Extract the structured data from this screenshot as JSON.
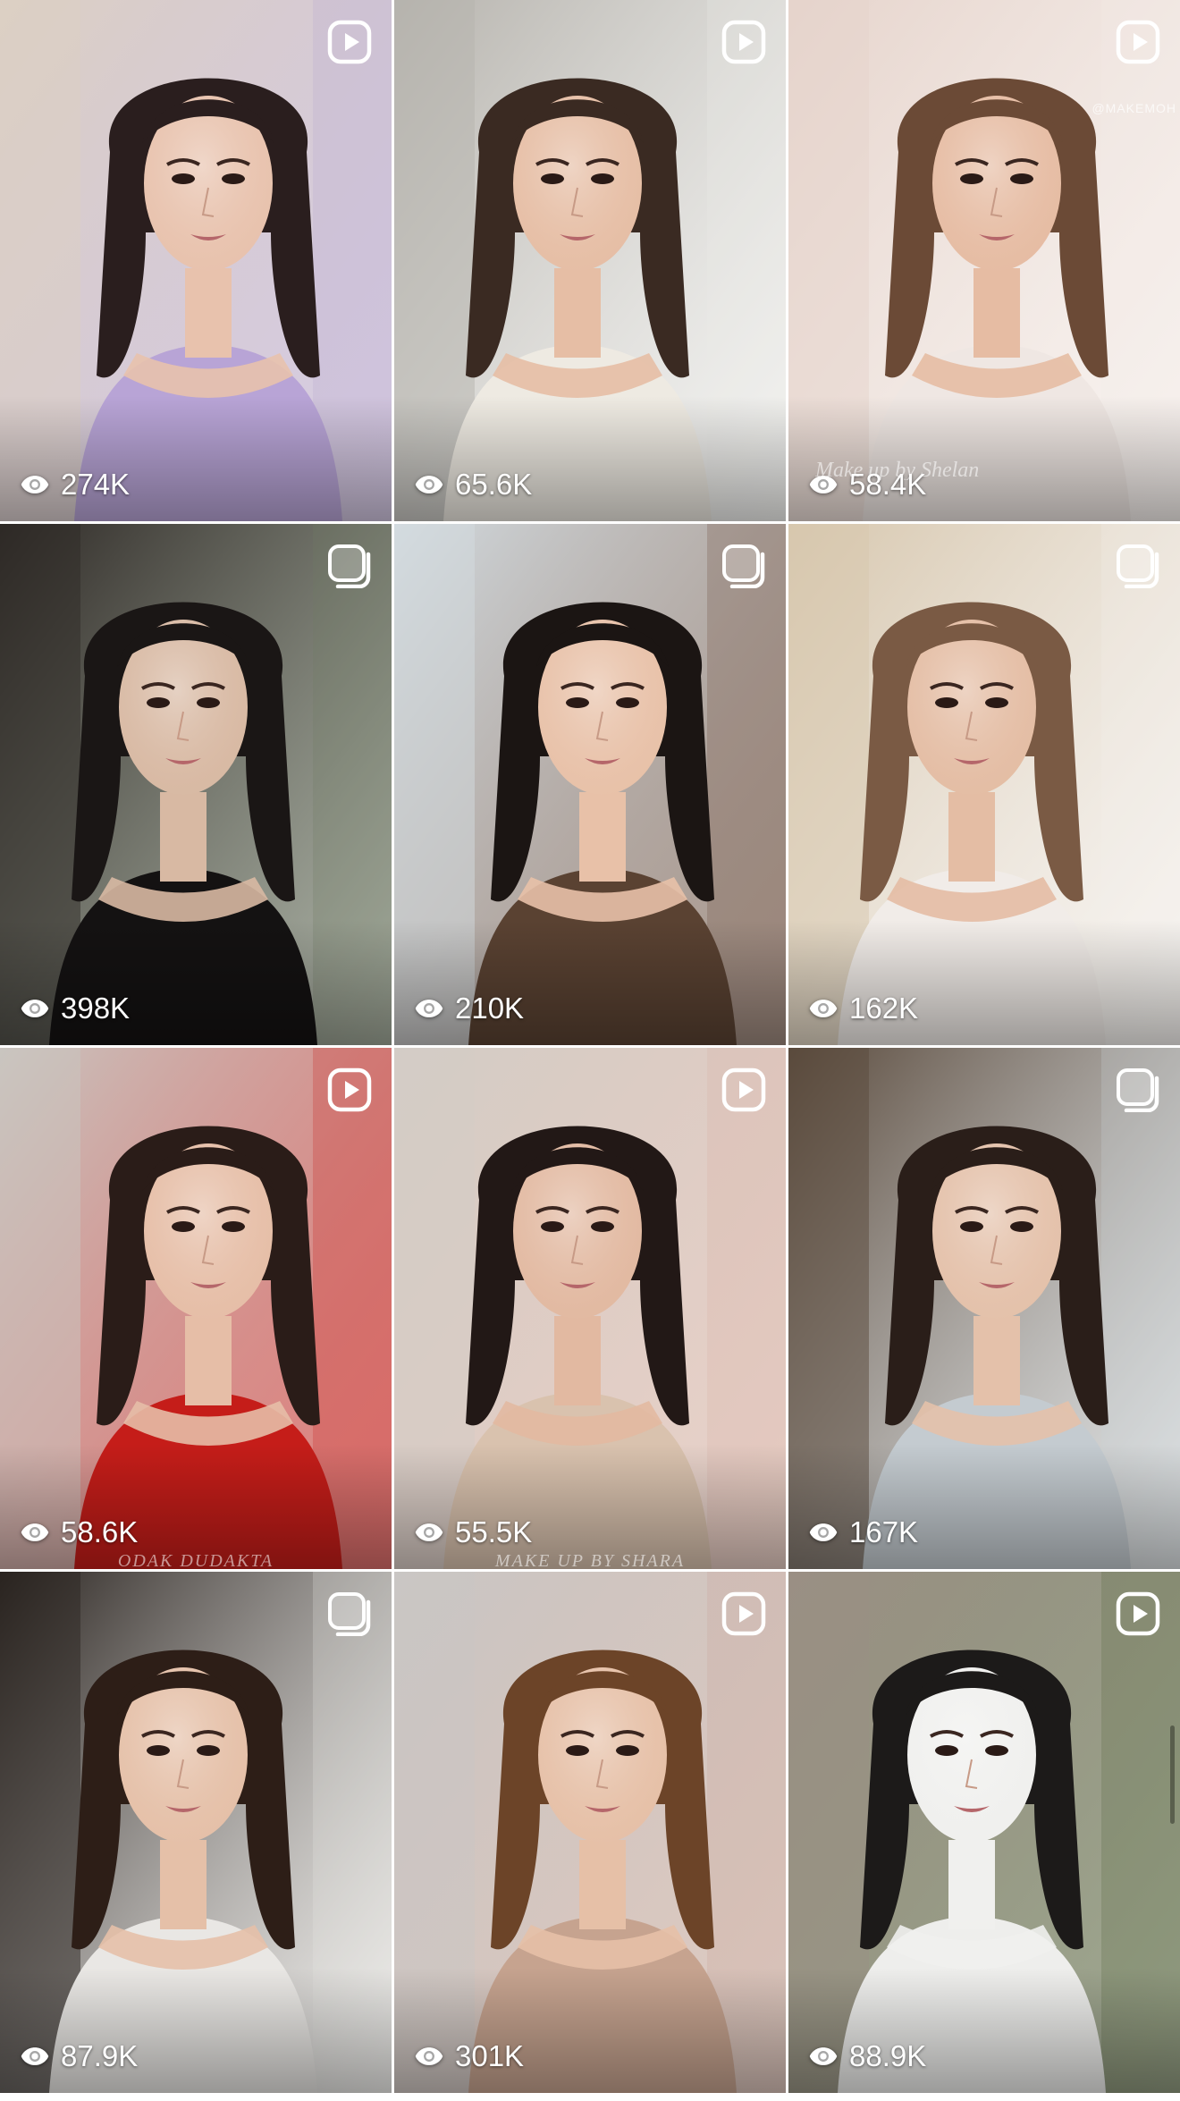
{
  "tiles": [
    {
      "views": "274K",
      "type": "reel",
      "caption": "",
      "palette": {
        "bg": "#dcd0c4",
        "accent": "#b9a7cf",
        "figure": "#e8c2ad",
        "hair": "#2a1e1e",
        "dress": "#b8a4d6"
      }
    },
    {
      "views": "65.6K",
      "type": "reel",
      "caption": "",
      "palette": {
        "bg": "#b6b3ad",
        "accent": "#ecece9",
        "figure": "#e6bea5",
        "hair": "#3a2a22",
        "dress": "#eeeae2"
      }
    },
    {
      "views": "58.4K",
      "type": "reel",
      "caption": "Make up by Shelan",
      "caption_alt": "@MAKEMOH",
      "palette": {
        "bg": "#e6d4cc",
        "accent": "#f3ebe6",
        "figure": "#e6bca3",
        "hair": "#6b4a36",
        "dress": "#efe7e3"
      }
    },
    {
      "views": "398K",
      "type": "clip",
      "caption": "",
      "palette": {
        "bg": "#2e2926",
        "accent": "#6f7a64",
        "figure": "#d8b9a3",
        "hair": "#1a1615",
        "dress": "#141212"
      }
    },
    {
      "views": "210K",
      "type": "clip",
      "caption": "",
      "palette": {
        "bg": "#d3dbe0",
        "accent": "#6a4c3a",
        "figure": "#e8c1a8",
        "hair": "#1b1513",
        "dress": "#5a4232"
      }
    },
    {
      "views": "162K",
      "type": "clip",
      "caption": "",
      "palette": {
        "bg": "#d7c7ae",
        "accent": "#f2eeea",
        "figure": "#e4bda4",
        "hair": "#7a5a44",
        "dress": "#f1ece8"
      }
    },
    {
      "views": "58.6K",
      "type": "reel",
      "caption": "ODAK DUDAKTA",
      "palette": {
        "bg": "#c9c5c0",
        "accent": "#c7231e",
        "figure": "#e6bea7",
        "hair": "#2a1c18",
        "dress": "#c51d19"
      }
    },
    {
      "views": "55.5K",
      "type": "reel",
      "caption": "MAKE UP BY SHARA",
      "palette": {
        "bg": "#d3ccc6",
        "accent": "#d9b1a2",
        "figure": "#e2b9a1",
        "hair": "#221816",
        "dress": "#d9c2ae"
      }
    },
    {
      "views": "167K",
      "type": "clip",
      "caption": "",
      "palette": {
        "bg": "#5a4a3c",
        "accent": "#cdd3d6",
        "figure": "#e4c1aa",
        "hair": "#2a1e19",
        "dress": "#c4cbd0"
      }
    },
    {
      "views": "87.9K",
      "type": "clip",
      "caption": "",
      "palette": {
        "bg": "#2a2420",
        "accent": "#e8e6e2",
        "figure": "#e5c0a8",
        "hair": "#2d1e17",
        "dress": "#e9e7e4"
      }
    },
    {
      "views": "301K",
      "type": "reel",
      "caption": "",
      "palette": {
        "bg": "#c9c6c4",
        "accent": "#c7a596",
        "figure": "#e6c0a7",
        "hair": "#6c4428",
        "dress": "#c6a38f"
      }
    },
    {
      "views": "88.9K",
      "type": "reel",
      "caption": "",
      "palette": {
        "bg": "#9a8f84",
        "accent": "#58683f",
        "figure": "#f0f0ee",
        "hair": "#1c1a19",
        "dress": "#eeeeec"
      }
    }
  ],
  "icons": {
    "reel": "play-badge-icon",
    "clip": "clip-badge-icon",
    "views": "eye-icon"
  }
}
